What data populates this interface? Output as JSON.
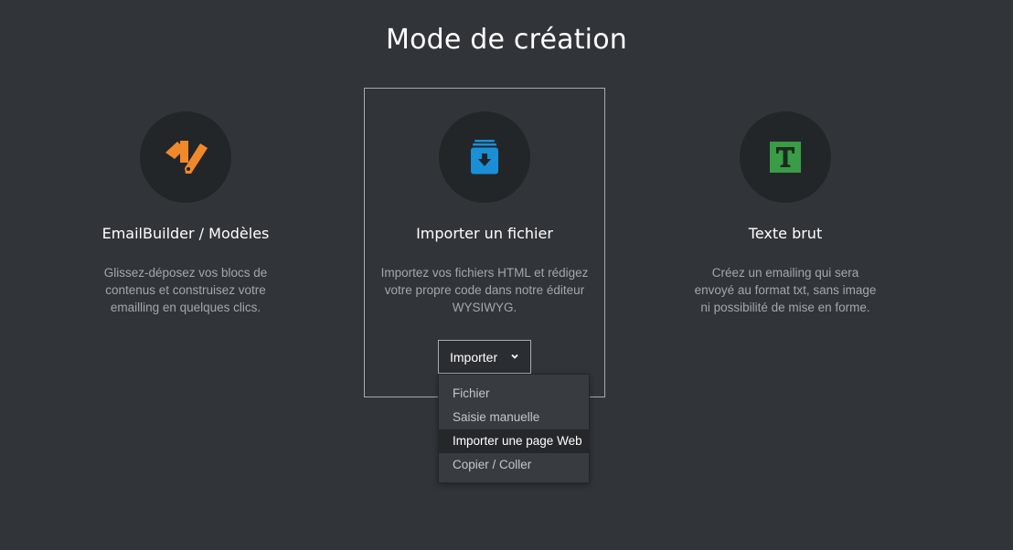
{
  "page": {
    "title": "Mode de création"
  },
  "cards": [
    {
      "title": "EmailBuilder / Modèles",
      "description": "Glissez-déposez vos blocs de contenus et construisez votre emailling en quelques clics.",
      "icon": "swatch-palette-icon",
      "icon_color": "#f0892a"
    },
    {
      "title": "Importer un fichier",
      "description": "Importez vos fichiers HTML et rédigez votre propre code dans notre éditeur WYSIWYG.",
      "icon": "import-inbox-icon",
      "icon_color": "#1a8fd6",
      "selected": true
    },
    {
      "title": "Texte brut",
      "description": "Créez un emailing qui sera envoyé au format txt, sans image ni possibilité de mise en forme.",
      "icon": "text-t-icon",
      "icon_color": "#3a9c46",
      "icon_glyph": "T"
    }
  ],
  "import_button": {
    "label": "Importer"
  },
  "dropdown": {
    "items": [
      {
        "label": "Fichier"
      },
      {
        "label": "Saisie manuelle"
      },
      {
        "label": "Importer une page Web",
        "highlighted": true
      },
      {
        "label": "Copier / Coller"
      }
    ]
  },
  "colors": {
    "background": "#31353a",
    "circle": "#232629",
    "selected_border": "#a8abae",
    "dropdown_bg": "#383c41",
    "dropdown_highlight": "#25282b"
  }
}
